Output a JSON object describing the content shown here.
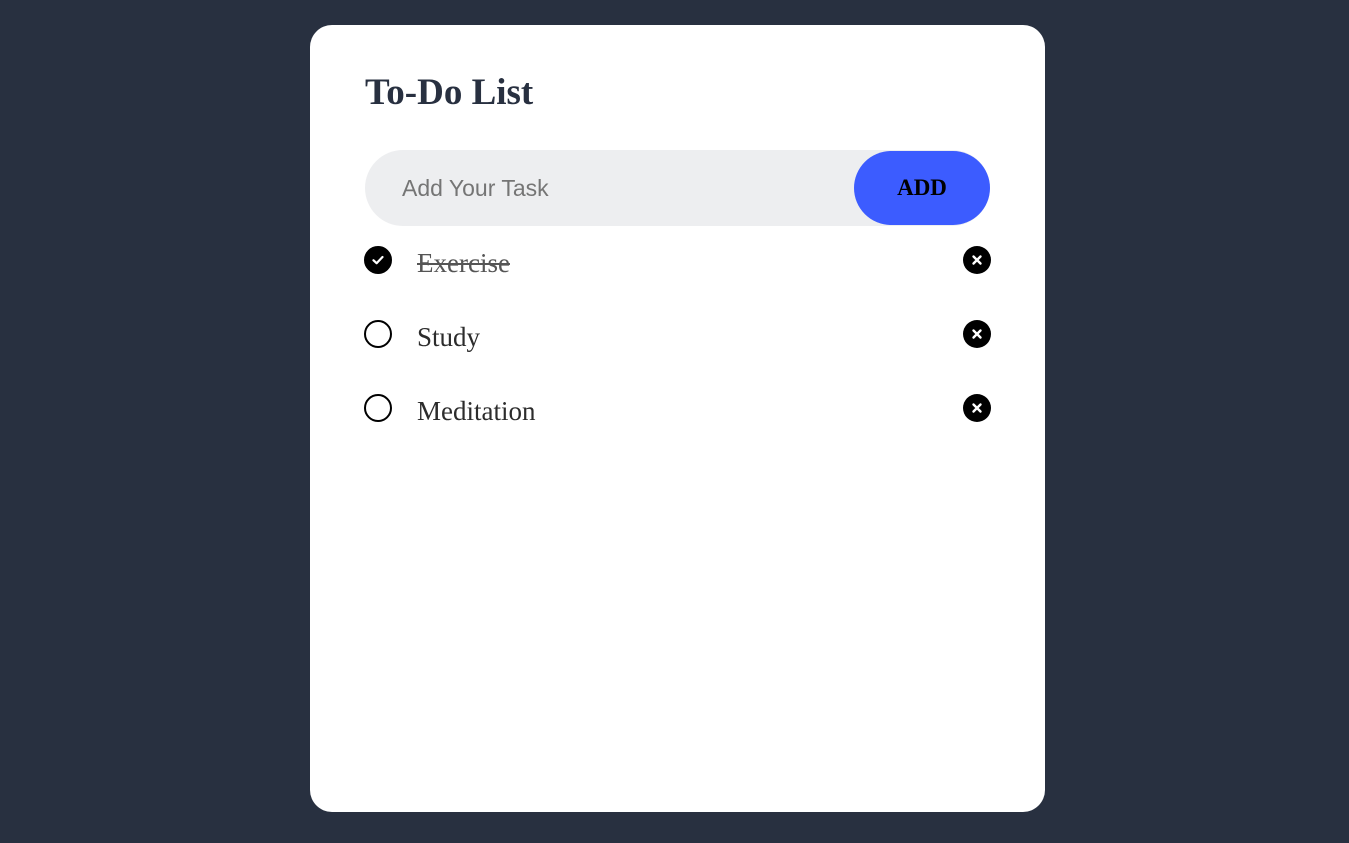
{
  "app": {
    "title": "To-Do List"
  },
  "input": {
    "placeholder": "Add Your Task",
    "value": "",
    "add_label": "ADD"
  },
  "tasks": [
    {
      "label": "Exercise",
      "checked": true
    },
    {
      "label": "Study",
      "checked": false
    },
    {
      "label": "Meditation",
      "checked": false
    }
  ],
  "icons": {
    "checked": "check-circle-icon",
    "unchecked": "empty-circle-icon",
    "remove": "close-circle-icon"
  },
  "colors": {
    "background": "#283040",
    "card": "#ffffff",
    "accent": "#3c5cff",
    "input_bg": "#edeef0"
  }
}
